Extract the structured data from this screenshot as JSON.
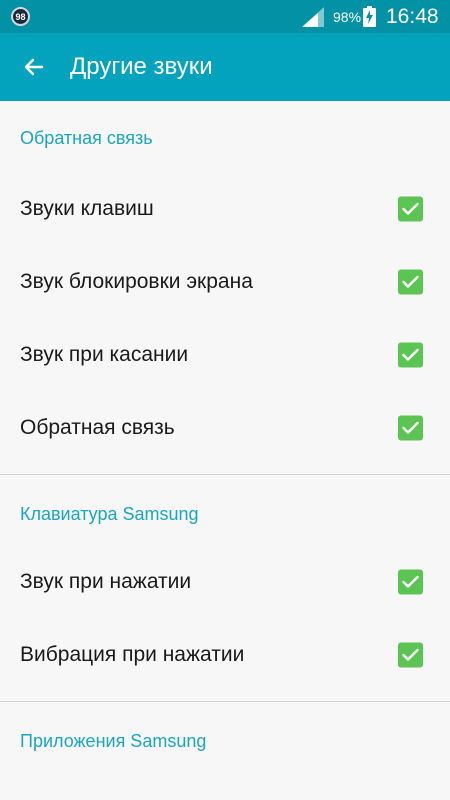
{
  "status_bar": {
    "badge": "98",
    "battery": "98%",
    "time": "16:48"
  },
  "app_bar": {
    "title": "Другие звуки",
    "back_icon": "arrow-left-icon"
  },
  "colors": {
    "accent": "#04a3bd",
    "status_bar": "#0391a6",
    "checkbox": "#5bc453",
    "section_text": "#1ba6c0"
  },
  "sections": [
    {
      "title": "Обратная связь",
      "items": [
        {
          "label": "Звуки клавиш",
          "checked": true
        },
        {
          "label": "Звук блокировки экрана",
          "checked": true
        },
        {
          "label": "Звук при касании",
          "checked": true
        },
        {
          "label": "Обратная связь",
          "checked": true
        }
      ]
    },
    {
      "title": "Клавиатура Samsung",
      "items": [
        {
          "label": "Звук при нажатии",
          "checked": true
        },
        {
          "label": "Вибрация при нажатии",
          "checked": true
        }
      ]
    },
    {
      "title": "Приложения Samsung",
      "items": []
    }
  ]
}
